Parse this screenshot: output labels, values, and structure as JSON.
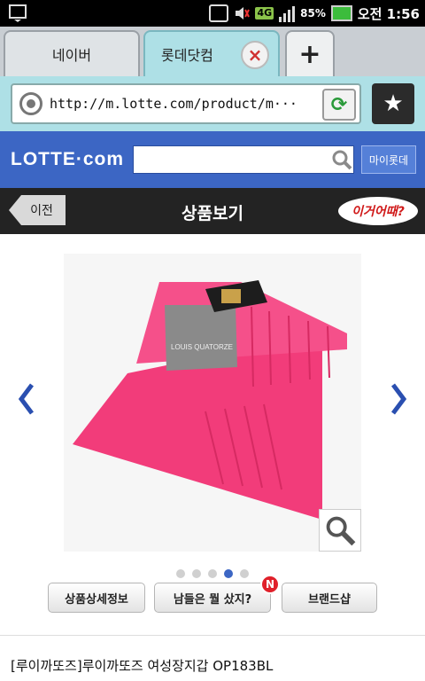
{
  "status_bar": {
    "network": "4G",
    "battery": "85%",
    "time": "오전 1:56",
    "icons": [
      "usb-debug-icon",
      "mute-icon",
      "signal-icon",
      "battery-icon"
    ]
  },
  "tabs": [
    {
      "label": "네이버",
      "active": false
    },
    {
      "label": "롯데닷컴",
      "active": true
    }
  ],
  "tab_close_glyph": "×",
  "new_tab_glyph": "+",
  "url_bar": {
    "url": "http://m.lotte.com/product/m···",
    "refresh_glyph": "⟳",
    "bookmark_glyph": "★"
  },
  "lotte_header": {
    "logo": "LOTTE·com",
    "search_value": "",
    "mylotte_label": "마이롯데"
  },
  "title_bar": {
    "back_label": "이전",
    "title": "상품보기",
    "bubble": "이거어때?"
  },
  "carousel": {
    "image_text": "LOUIS QUATORZE",
    "current_page": 4,
    "total_pages": 5
  },
  "actions": {
    "detail_label": "상품상세정보",
    "others_label": "남들은 뭘 샀지?",
    "new_badge": "N",
    "brand_label": "브랜드샵"
  },
  "product": {
    "name": "[루이까또즈]루이까또즈 여성장지갑 OP183BL"
  },
  "colors": {
    "accent_blue": "#3c66c4",
    "wallet_pink": "#f23c7a",
    "title_bar": "#232323",
    "tab_active": "#aee0e6"
  }
}
